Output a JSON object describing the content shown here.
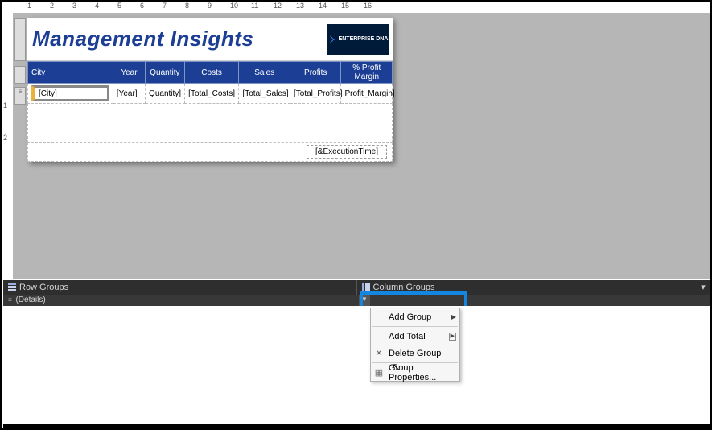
{
  "report_title": "Management Insights",
  "logo_text": "ENTERPRISE DNA",
  "table": {
    "headers": {
      "city": "City",
      "year": "Year",
      "quantity": "Quantity",
      "costs": "Costs",
      "sales": "Sales",
      "profits": "Profits",
      "margin": "% Profit\nMargin"
    },
    "row": {
      "city": "[City]",
      "year": "[Year]",
      "quantity": "Quantity]",
      "total_costs": "[Total_Costs]",
      "total_sales": "[Total_Sales]",
      "total_profits": "[Total_Profits]",
      "profit_margin": "Profit_Margin]"
    }
  },
  "execution_time": "[&ExecutionTime]",
  "panels": {
    "row_groups": "Row Groups",
    "column_groups": "Column Groups",
    "details_label": "(Details)"
  },
  "context_menu": {
    "add_group": "Add Group",
    "add_total": "Add Total",
    "delete_group": "Delete Group",
    "group_properties": "Group Properties..."
  },
  "ruler_numbers": [
    "1",
    "2",
    "3",
    "4",
    "5",
    "6",
    "7",
    "8",
    "9",
    "10",
    "11",
    "12",
    "13",
    "14",
    "15",
    "16"
  ],
  "vruler_numbers": [
    "1",
    "2"
  ]
}
